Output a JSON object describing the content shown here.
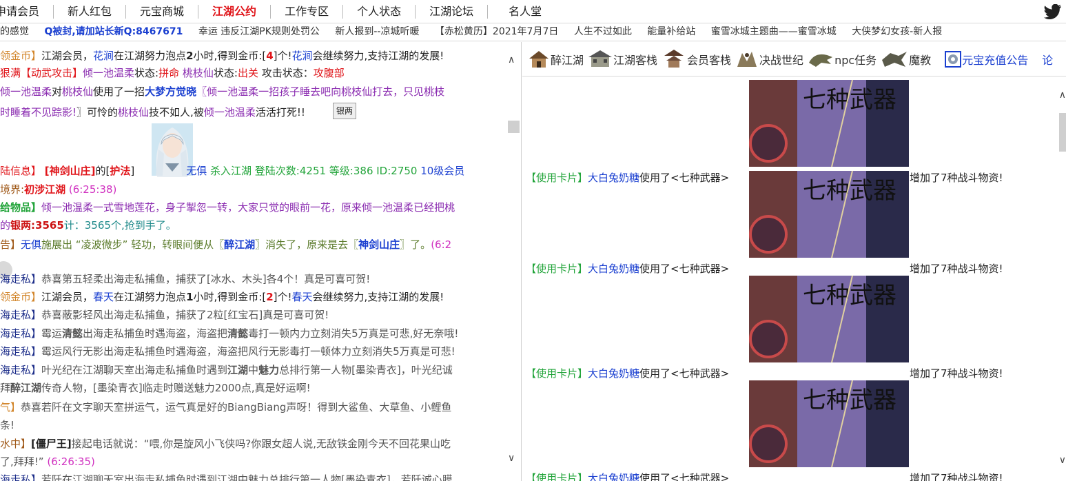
{
  "topnav": {
    "items": [
      "申请会员",
      "新人红包",
      "元宝商城",
      "江湖公约",
      "工作专区",
      "个人状态",
      "江湖论坛",
      "名人堂"
    ],
    "active": "江湖公约"
  },
  "ticker": {
    "items": [
      "的感觉",
      "Q被封,请加站长新Q:8467671",
      "幸运 违反江湖PK规则处罚公",
      "新人报到--凉城听暖",
      "【赤松黄历】2021年7月7日",
      "人生不过如此",
      "能量补给站",
      "蜜雪冰城主题曲——蜜雪冰城",
      "大侠梦幻女孩-新人报"
    ]
  },
  "chat": {
    "l1": {
      "a": "领金币】",
      "b": "江湖会员，",
      "c": "花涧",
      "d": "在江湖努力泡点",
      "e": "2",
      "f": "小时,得到金币:[",
      "g": "4",
      "h": "]个!",
      "i": "花涧",
      "j": "会继续努力,支持江湖的发展!"
    },
    "l2": {
      "a": "狠满【动武攻击】",
      "b": "倾一池温柔",
      "c": "状态:",
      "d": "拼命",
      "e": "桃枝仙",
      "f": "状态:",
      "g": "出关",
      "h": " 攻击状态：",
      "i": "攻腹部"
    },
    "l3": {
      "a": "倾一池温柔",
      "b": "对",
      "c": "桃枝仙",
      "d": "使用了一招",
      "e": "大梦方觉晓",
      "f": "〖倾一池温柔一招孩子睡去吧向桃枝仙打去，只见桃枝"
    },
    "l4": {
      "a": "时睡着不见踪影!",
      "b": "〗可怜的",
      "c": "桃枝仙",
      "d": "技不如人,被",
      "e": "倾一池温柔",
      "f": "活活打死!!"
    },
    "yinliang_button": "银两",
    "l5": {
      "a": "陆信息】",
      "b": "[神剑山庄]",
      "c": "的[",
      "d": "护法",
      "e": "]",
      "f": "无俱",
      "g": " 杀入江湖 登陆次数:4251 等级:386 ID:2750",
      "h": " 10级会员"
    },
    "l6": {
      "a": "境界:",
      "b": "初涉江湖",
      "c": " (6:25:38)"
    },
    "l7": {
      "a": "给物品】",
      "b": "倾一池温柔",
      "c": "一式雪地莲花，身子掣忽一转，大家只觉的眼前一花，原来",
      "d": "倾一池温柔",
      "e": "已经把桃"
    },
    "l8": {
      "a": "的",
      "b": "银两:3565",
      "c": "计：3565个,抢到手了。"
    },
    "l9": {
      "a": "告】",
      "b": "无俱",
      "c": "施展出 “凌波微步” 轻功，转眼间便从〖",
      "d": "醉江湖",
      "e": "〗消失了，原来是去〖",
      "f": "神剑山庄",
      "g": "〗了。",
      "h": "(6:2"
    },
    "l10": {
      "a": "海走私】",
      "b": "恭喜第五轻柔出海走私捕鱼，捕获了[冰水、木头]各4个！真是可喜可贺!"
    },
    "l11": {
      "a": "领金币】",
      "b": "江湖会员，",
      "c": "春天",
      "d": "在江湖努力泡点",
      "e": "1",
      "f": "小时,得到金币:[",
      "g": "2",
      "h": "]个!",
      "i": "春天",
      "j": "会继续努力,支持江湖的发展!"
    },
    "l12": {
      "a": "海走私】",
      "b": "恭喜蔽影轻风出海走私捕鱼，捕获了2粒[红宝石]真是可喜可贺!"
    },
    "l13": {
      "a": "海走私】",
      "b": "霉运",
      "c": "清懿",
      "d": "出海走私捕鱼时遇海盗，海盗把",
      "e": "清懿",
      "f": "毒打一顿内力立刻消失5万真是可悲,好无奈哦!"
    },
    "l14": {
      "a": "海走私】",
      "b": "霉运",
      "c": "风行无影",
      "d": "出海走私捕鱼时遇海盗，海盗把",
      "e": "风行无影",
      "f": "毒打一顿体力立刻消失5万真是可悲!"
    },
    "l15": {
      "a": "海走私】",
      "b": "叶光纪在江湖聊天室出海走私捕鱼时遇到",
      "c": "江湖",
      "d": "中",
      "e": "魅力",
      "f": "总排行第一人物[墨染青衣]，叶光纪诚"
    },
    "l16": {
      "a": "拜",
      "b": "醉江湖",
      "c": "传奇人物，[墨染青衣]临走时赠送魅力2000点,真是好运啊!"
    },
    "l17": {
      "a": "气】",
      "b": "恭喜若阡在文字聊天室拼运气，运气真是好的BiangBiang声呀！得到大鲨鱼、大草鱼、小鲤鱼"
    },
    "l18": {
      "a": "条!"
    },
    "l19": {
      "a": "水中】",
      "b": "[僵尸王]",
      "c": "接起电话就说：“喂,你是旋风小飞侠吗?你跟女超人说,无敌铁金刚今天不回花果山吃"
    },
    "l20": {
      "a": "了,拜拜!”",
      "b": "(6:26:35)"
    },
    "l21": {
      "a": "海走私】",
      "b": "若阡在江湖聊天室出海走私捕鱼时遇到江湖中魅力总排行第一人物[墨染青衣]，若阡诚心膜"
    }
  },
  "rightnav": {
    "items": [
      {
        "label": "醉江湖",
        "icon": "house-icon"
      },
      {
        "label": "江湖客栈",
        "icon": "inn-icon"
      },
      {
        "label": "会员客栈",
        "icon": "pagoda-icon"
      },
      {
        "label": "决战世纪",
        "icon": "battle-icon"
      },
      {
        "label": "npc任务",
        "icon": "dragon-icon"
      },
      {
        "label": "魔教",
        "icon": "demon-icon"
      },
      {
        "label": "元宝充值公告",
        "icon": "coin-icon"
      },
      {
        "label": "论",
        "icon": ""
      }
    ]
  },
  "feed": {
    "rows": [
      {
        "prefix": "【使用卡片】",
        "user": "大白兔奶糖",
        "action": "使用了<七种武器>",
        "suffix": "增加了7种战斗物资!"
      },
      {
        "prefix": "【使用卡片】",
        "user": "大白兔奶糖",
        "action": "使用了<七种武器>",
        "suffix": "增加了7种战斗物资!"
      },
      {
        "prefix": "【使用卡片】",
        "user": "大白兔奶糖",
        "action": "使用了<七种武器>",
        "suffix": "增加了7种战斗物资!"
      },
      {
        "prefix": "【使用卡片】",
        "user": "大白兔奶糖",
        "action": "使用了<七种武器>",
        "suffix": "增加了7种战斗物资!"
      }
    ],
    "card_title": "七种武器"
  },
  "colors": {
    "accent_red": "#e0151a",
    "link_blue": "#1a3fd0",
    "green": "#22a43a",
    "purple": "#8a2bb0"
  }
}
